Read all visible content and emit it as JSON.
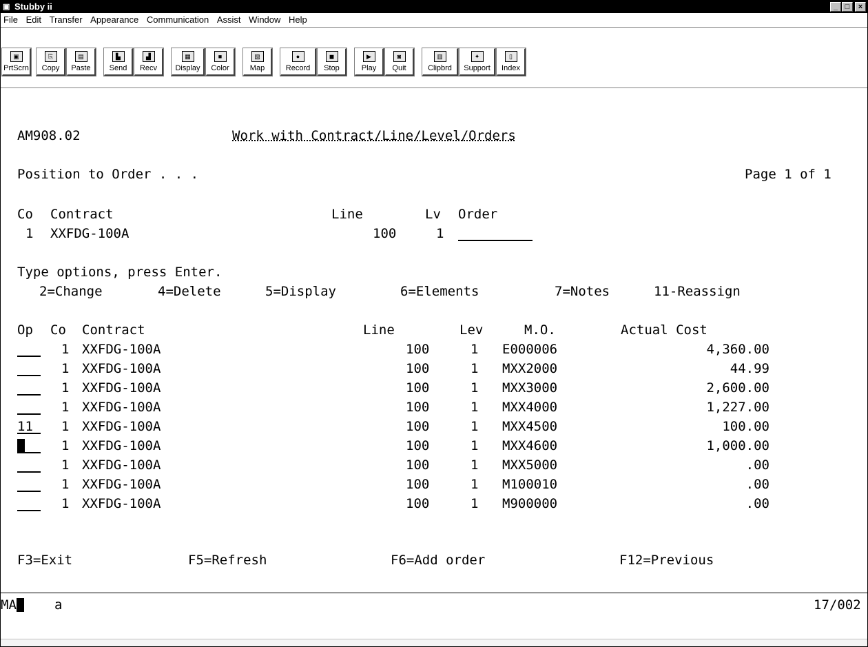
{
  "window": {
    "title": "Stubby ii",
    "controls": [
      "_",
      "□",
      "×"
    ]
  },
  "menu": [
    "File",
    "Edit",
    "Transfer",
    "Appearance",
    "Communication",
    "Assist",
    "Window",
    "Help"
  ],
  "toolbar": [
    {
      "label": "PrtScrn",
      "icon": "print-screen-icon"
    },
    {
      "label": "Copy",
      "icon": "copy-icon"
    },
    {
      "label": "Paste",
      "icon": "paste-icon"
    },
    {
      "label": "Send",
      "icon": "send-icon"
    },
    {
      "label": "Recv",
      "icon": "receive-icon"
    },
    {
      "label": "Display",
      "icon": "display-icon"
    },
    {
      "label": "Color",
      "icon": "color-icon"
    },
    {
      "label": "Map",
      "icon": "map-icon"
    },
    {
      "label": "Record",
      "icon": "record-icon"
    },
    {
      "label": "Stop",
      "icon": "stop-icon"
    },
    {
      "label": "Play",
      "icon": "play-icon"
    },
    {
      "label": "Quit",
      "icon": "quit-icon"
    },
    {
      "label": "Clipbrd",
      "icon": "clipboard-icon"
    },
    {
      "label": "Support",
      "icon": "support-icon"
    },
    {
      "label": "Index",
      "icon": "index-icon"
    }
  ],
  "screen": {
    "program_id": "AM908.02",
    "title": "Work with Contract/Line/Level/Orders",
    "position_label": "Position to Order . . .",
    "page": "Page 1 of 1",
    "header": {
      "labels": {
        "co": "Co",
        "contract": "Contract",
        "line": "Line",
        "lv": "Lv",
        "order": "Order"
      },
      "values": {
        "co": "1",
        "contract": "XXFDG-100A",
        "line": "100",
        "lv": "1",
        "order": ""
      }
    },
    "instructions": "Type options, press Enter.",
    "options": [
      "2=Change",
      "4=Delete",
      "5=Display",
      "6=Elements",
      "7=Notes",
      "11-Reassign"
    ],
    "columns": {
      "op": "Op",
      "co": "Co",
      "contract": "Contract",
      "line": "Line",
      "lev": "Lev",
      "mo": "M.O.",
      "cost": "Actual Cost"
    },
    "rows": [
      {
        "op": "",
        "co": "1",
        "contract": "XXFDG-100A",
        "line": "100",
        "lev": "1",
        "mo": "E000006",
        "cost": "4,360.00"
      },
      {
        "op": "",
        "co": "1",
        "contract": "XXFDG-100A",
        "line": "100",
        "lev": "1",
        "mo": "MXX2000",
        "cost": "44.99"
      },
      {
        "op": "",
        "co": "1",
        "contract": "XXFDG-100A",
        "line": "100",
        "lev": "1",
        "mo": "MXX3000",
        "cost": "2,600.00"
      },
      {
        "op": "",
        "co": "1",
        "contract": "XXFDG-100A",
        "line": "100",
        "lev": "1",
        "mo": "MXX4000",
        "cost": "1,227.00"
      },
      {
        "op": "11",
        "co": "1",
        "contract": "XXFDG-100A",
        "line": "100",
        "lev": "1",
        "mo": "MXX4500",
        "cost": "100.00"
      },
      {
        "op": "",
        "co": "1",
        "contract": "XXFDG-100A",
        "line": "100",
        "lev": "1",
        "mo": "MXX4600",
        "cost": "1,000.00",
        "cursor": true
      },
      {
        "op": "",
        "co": "1",
        "contract": "XXFDG-100A",
        "line": "100",
        "lev": "1",
        "mo": "MXX5000",
        "cost": ".00"
      },
      {
        "op": "",
        "co": "1",
        "contract": "XXFDG-100A",
        "line": "100",
        "lev": "1",
        "mo": "M100010",
        "cost": ".00"
      },
      {
        "op": "",
        "co": "1",
        "contract": "XXFDG-100A",
        "line": "100",
        "lev": "1",
        "mo": "M900000",
        "cost": ".00"
      }
    ],
    "fkeys": [
      "F3=Exit",
      "F5=Refresh",
      "F6=Add order",
      "F12=Previous"
    ]
  },
  "status": {
    "left": "MA",
    "mode": "a",
    "position": "17/002"
  }
}
